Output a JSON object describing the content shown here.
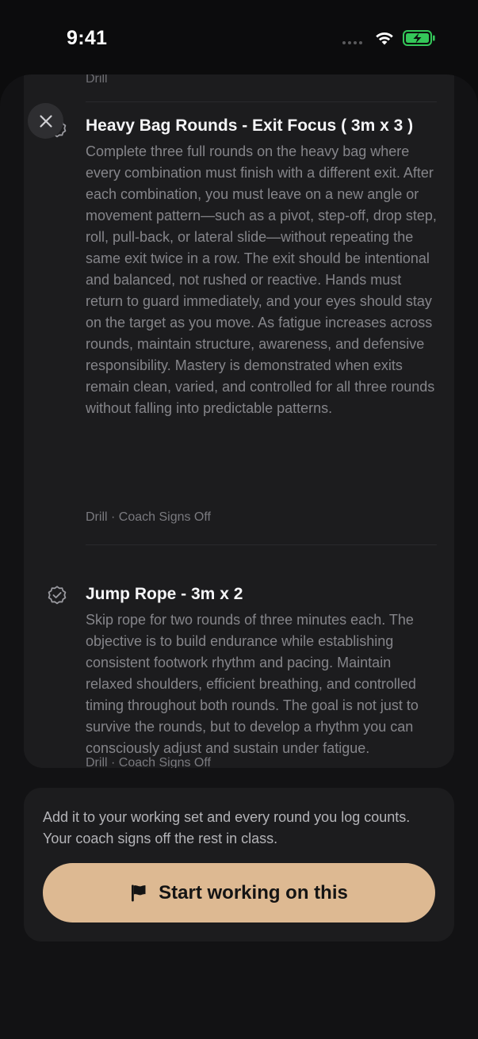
{
  "status_bar": {
    "time": "9:41"
  },
  "previous_item": {
    "tag": "Drill"
  },
  "drills": [
    {
      "title": "Heavy Bag Rounds - Exit Focus ( 3m x 3 )",
      "description": "Complete three full rounds on the heavy bag where every combination must finish with a different exit. After each combination, you must leave on a new angle or movement pattern—such as a pivot, step-off, drop step, roll, pull-back, or lateral slide—without repeating the same exit twice in a row. The exit should be intentional and balanced, not rushed or reactive. Hands must return to guard immediately, and your eyes should stay on the target as you move. As fatigue increases across rounds, maintain structure, awareness, and defensive responsibility. Mastery is demonstrated when exits remain clean, varied, and controlled for all three rounds without falling into predictable patterns.",
      "meta": "Drill · Coach Signs Off",
      "icon": "badge-check-icon"
    },
    {
      "title": "Jump Rope - 3m x 2",
      "description": "Skip rope for two rounds of three minutes each. The objective is to build endurance while establishing consistent footwork rhythm and pacing. Maintain relaxed shoulders, efficient breathing, and controlled timing throughout both rounds. The goal is not just to survive the rounds, but to develop a rhythm you can consciously adjust and sustain under fatigue.",
      "meta": "Drill · Coach Signs Off",
      "icon": "badge-check-icon"
    }
  ],
  "cta": {
    "text": "Add it to your working set and every round you log counts. Your coach signs off the rest in class.",
    "button_label": "Start working on this",
    "button_icon": "flag-icon"
  },
  "colors": {
    "background": "#0c0c0d",
    "sheet": "#121214",
    "card": "#1c1c1e",
    "accent": "#ddb992",
    "battery": "#34c759"
  }
}
